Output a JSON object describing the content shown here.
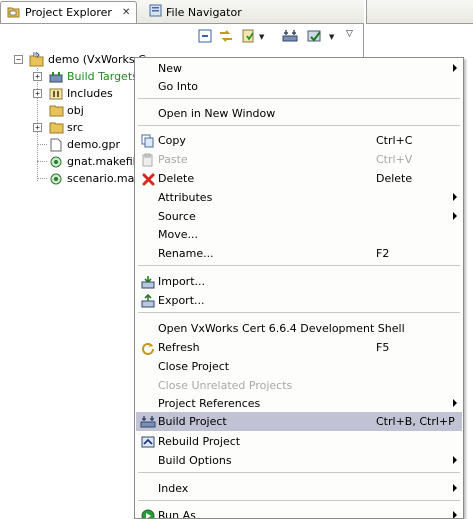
{
  "tabs": {
    "project_explorer": "Project Explorer",
    "file_navigator": "File Navigator"
  },
  "tree": {
    "root": "demo (VxWorks C",
    "children": [
      "Build Targets",
      "Includes",
      "obj",
      "src",
      "demo.gpr",
      "gnat.makefile",
      "scenario.make"
    ]
  },
  "menu": {
    "new": "New",
    "go_into": "Go Into",
    "open_new_window": "Open in New Window",
    "copy": "Copy",
    "copy_acc": "Ctrl+C",
    "paste": "Paste",
    "paste_acc": "Ctrl+V",
    "delete": "Delete",
    "delete_acc": "Delete",
    "attributes": "Attributes",
    "source": "Source",
    "move": "Move...",
    "rename": "Rename...",
    "rename_acc": "F2",
    "import": "Import...",
    "export": "Export...",
    "open_shell": "Open VxWorks Cert 6.6.4 Development Shell",
    "refresh": "Refresh",
    "refresh_acc": "F5",
    "close_project": "Close Project",
    "close_unrelated": "Close Unrelated Projects",
    "project_references": "Project References",
    "build_project": "Build Project",
    "build_project_acc": "Ctrl+B, Ctrl+P",
    "rebuild_project": "Rebuild Project",
    "build_options": "Build Options",
    "index": "Index",
    "run_as": "Run As"
  },
  "colors": {
    "menu_highlight": "#c1c2d3",
    "disabled_text": "#a8a8a8",
    "tree_green_text": "#1e8a1e",
    "delete_icon_red": "#d8281e"
  },
  "icons": {
    "project": "project-folder-icon",
    "copy": "copy-icon",
    "paste": "paste-icon",
    "delete": "red-x-icon",
    "import": "import-icon",
    "export": "export-icon",
    "refresh": "refresh-icon",
    "build": "build-icon",
    "rebuild": "rebuild-icon",
    "run": "run-icon"
  }
}
